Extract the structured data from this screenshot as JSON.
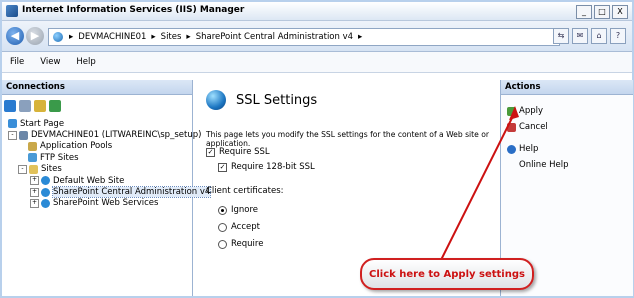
{
  "window": {
    "title": "Internet Information Services (IIS) Manager",
    "min": "_",
    "max": "□",
    "close": "X"
  },
  "address": {
    "crumbs": [
      "DEVMACHINE01",
      "Sites",
      "SharePoint Central Administration v4"
    ],
    "separator": "▸"
  },
  "menubar": [
    "File",
    "View",
    "Help"
  ],
  "connections": {
    "header": "Connections",
    "tree": [
      {
        "label": "Start Page",
        "icon": "start-page-icon",
        "level": 0
      },
      {
        "label": "DEVMACHINE01 (LITWAREINC\\sp_setup)",
        "icon": "server-icon",
        "level": 0,
        "expander": "-"
      },
      {
        "label": "Application Pools",
        "icon": "app-pools-icon",
        "level": 1
      },
      {
        "label": "FTP Sites",
        "icon": "ftp-sites-icon",
        "level": 1
      },
      {
        "label": "Sites",
        "icon": "sites-folder-icon",
        "level": 1,
        "expander": "-"
      },
      {
        "label": "Default Web Site",
        "icon": "website-globe-icon",
        "level": 2,
        "expander": "+"
      },
      {
        "label": "SharePoint Central Administration v4",
        "icon": "website-globe-icon",
        "level": 2,
        "expander": "+",
        "selected": true
      },
      {
        "label": "SharePoint Web Services",
        "icon": "website-globe-icon",
        "level": 2,
        "expander": "+"
      }
    ]
  },
  "content": {
    "title": "SSL Settings",
    "description": "This page lets you modify the SSL settings for the content of a Web site or application.",
    "require_ssl": "Require SSL",
    "require_128": "Require 128-bit SSL",
    "client_certs_label": "Client certificates:",
    "radios": [
      "Ignore",
      "Accept",
      "Require"
    ],
    "selected_radio": "Ignore"
  },
  "actions": {
    "header": "Actions",
    "items": [
      "Apply",
      "Cancel",
      "Help",
      "Online Help"
    ]
  },
  "callout": "Click here to Apply settings",
  "colors": {
    "accent": "#1f5eb0",
    "callout_red": "#cc1111"
  }
}
